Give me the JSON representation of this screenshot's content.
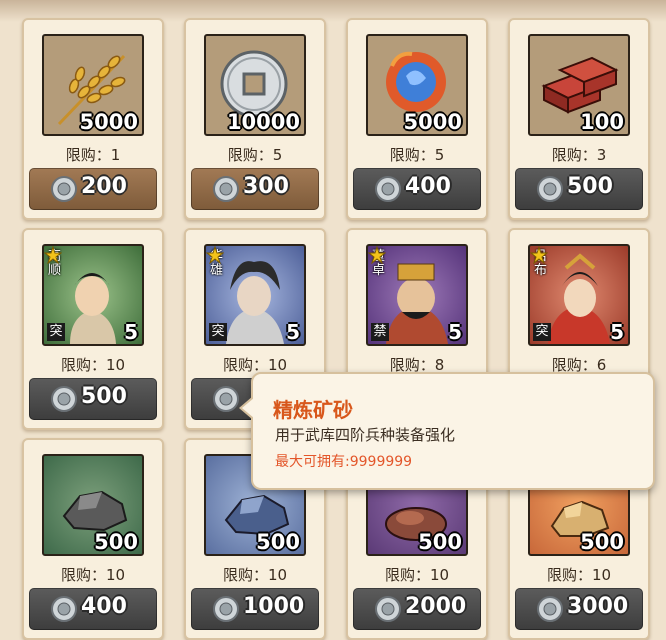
{
  "colors": {
    "tooltip_title": "#d8571b",
    "tooltip_max": "#e3562a",
    "card_bg": "#f8efdd",
    "btn_brown": "#8f6a46",
    "btn_gray": "#4a4a4a"
  },
  "rows": [
    [
      {
        "icon": "wheat-icon",
        "quantity": "5000",
        "limit": "限购：1",
        "price": "200",
        "button": "brown"
      },
      {
        "icon": "coin-icon",
        "quantity": "10000",
        "limit": "限购：5",
        "price": "300",
        "button": "brown"
      },
      {
        "icon": "flame-orb-icon",
        "quantity": "5000",
        "limit": "限购：5",
        "price": "400",
        "button": "gray"
      },
      {
        "icon": "brick-icon",
        "quantity": "100",
        "limit": "限购：3",
        "price": "500",
        "button": "gray"
      }
    ],
    [
      {
        "icon": "hero-portrait-icon",
        "vname": "高顺",
        "tag": "突",
        "stars": "5",
        "limit": "限购：10",
        "price": "500",
        "button": "gray"
      },
      {
        "icon": "hero-portrait-icon",
        "vname": "华雄",
        "tag": "突",
        "stars": "5",
        "limit": "限购：10",
        "price": "",
        "button": "gray"
      },
      {
        "icon": "hero-portrait-icon",
        "vname": "董卓",
        "tag": "禁",
        "stars": "5",
        "limit": "限购：8",
        "price": "",
        "button": "gray"
      },
      {
        "icon": "hero-portrait-icon",
        "vname": "吕布",
        "tag": "突",
        "stars": "5",
        "limit": "限购：6",
        "price": "",
        "button": "gray"
      }
    ],
    [
      {
        "icon": "ore-icon",
        "quantity": "500",
        "limit": "限购：10",
        "price": "400",
        "button": "gray"
      },
      {
        "icon": "ore-icon",
        "quantity": "500",
        "limit": "限购：10",
        "price": "1000",
        "button": "gray"
      },
      {
        "icon": "ore-icon",
        "quantity": "500",
        "limit": "限购：10",
        "price": "2000",
        "button": "gray"
      },
      {
        "icon": "ore-icon",
        "quantity": "500",
        "limit": "限购：10",
        "price": "3000",
        "button": "gray"
      }
    ]
  ],
  "tooltip": {
    "title": "精炼矿砂",
    "description": "用于武库四阶兵种装备强化",
    "max_hold": "最大可拥有:9999999"
  }
}
